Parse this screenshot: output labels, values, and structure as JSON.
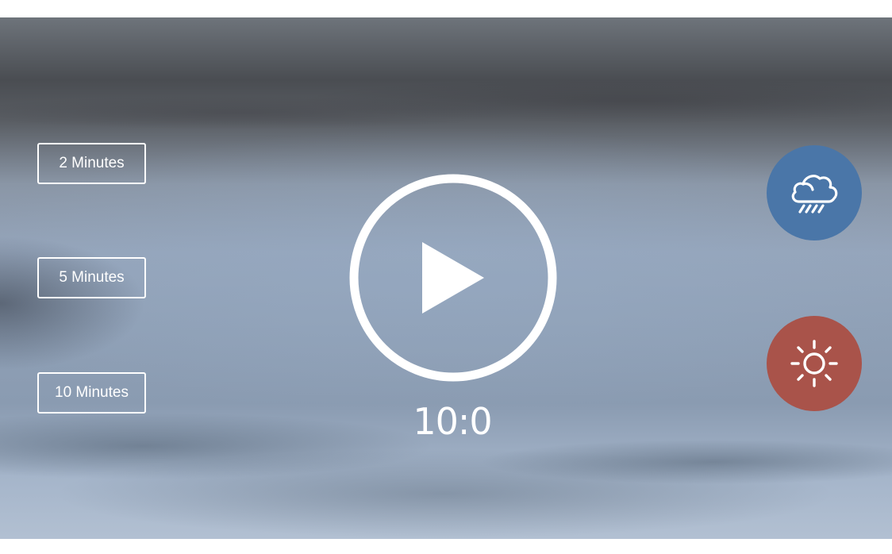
{
  "durations": [
    {
      "label": "2 Minutes"
    },
    {
      "label": "5 Minutes"
    },
    {
      "label": "10 Minutes"
    }
  ],
  "player": {
    "time_display": "10:0",
    "icon": "play-icon"
  },
  "sounds": [
    {
      "name": "rain",
      "icon": "rain-cloud-icon",
      "color": "#4a76a8"
    },
    {
      "name": "summer",
      "icon": "sun-icon",
      "color": "#a9534a"
    }
  ]
}
